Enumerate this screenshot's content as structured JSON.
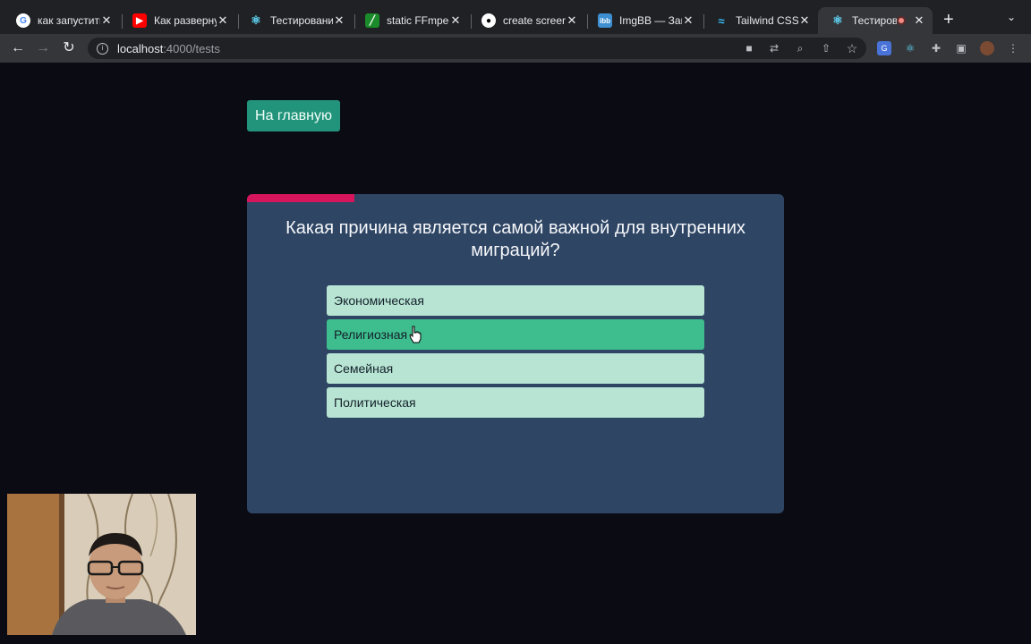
{
  "browser": {
    "tabs": [
      {
        "label": "как запустить",
        "icon": "google-icon",
        "active": false
      },
      {
        "label": "Как развернуть",
        "icon": "youtube-icon",
        "active": false
      },
      {
        "label": "Тестировани",
        "icon": "react-icon",
        "active": false
      },
      {
        "label": "static FFmpeg",
        "icon": "ffmpeg-icon",
        "active": false
      },
      {
        "label": "create screen",
        "icon": "github-icon",
        "active": false
      },
      {
        "label": "ImgBB — Загр",
        "icon": "imgbb-icon",
        "active": false
      },
      {
        "label": "Tailwind CSS",
        "icon": "tailwind-icon",
        "active": false
      },
      {
        "label": "Тестиров",
        "icon": "react-icon",
        "active": true
      }
    ],
    "close_glyph": "✕",
    "new_tab_glyph": "+",
    "url_host": "localhost",
    "url_path": ":4000/tests"
  },
  "page": {
    "home_button": "На главную",
    "progress_fraction": 0.2,
    "question": "Какая причина является самой важной для внутренних миграций?",
    "answers": [
      {
        "label": "Экономическая",
        "hovered": false
      },
      {
        "label": "Религиозная",
        "hovered": true
      },
      {
        "label": "Семейная",
        "hovered": false
      },
      {
        "label": "Политическая",
        "hovered": false
      }
    ]
  },
  "colors": {
    "page_bg": "#0b0b14",
    "card_bg": "#2f4564",
    "progress": "#d6155d",
    "home_button": "#23947c",
    "answer": "#b8e5d3",
    "answer_hover": "#3ebe8f"
  }
}
